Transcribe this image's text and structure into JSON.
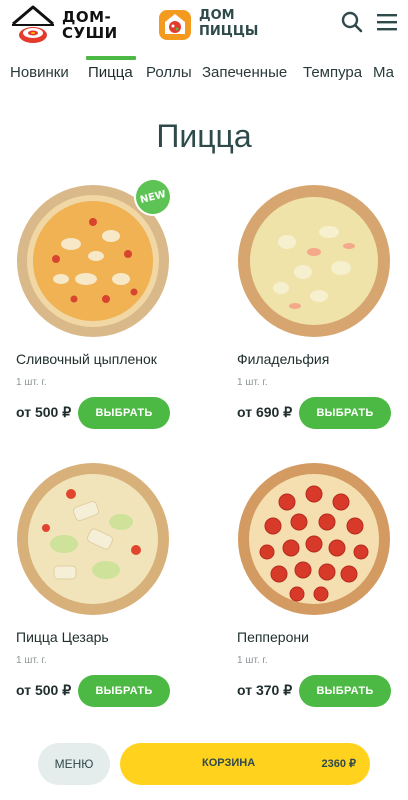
{
  "header": {
    "sushi_logo_line1": "ДОМ-",
    "sushi_logo_line2": "СУШИ",
    "pizza_logo_line1": "ДОМ",
    "pizza_logo_line2": "ПИЦЦЫ",
    "search_icon": "search-icon",
    "menu_icon": "hamburger-menu-icon"
  },
  "tabs": [
    {
      "label": "Новинки",
      "active": false
    },
    {
      "label": "Пицца",
      "active": true
    },
    {
      "label": "Роллы",
      "active": false
    },
    {
      "label": "Запеченные",
      "active": false
    },
    {
      "label": "Темпура",
      "active": false
    },
    {
      "label": "Ма",
      "active": false
    }
  ],
  "page_title": "Пицца",
  "products": [
    {
      "name": "Сливочный цыпленок",
      "unit": "1 шт. г.",
      "price": "от 500 ₽",
      "button": "ВЫБРАТЬ",
      "badge": "NEW",
      "style": "chicken"
    },
    {
      "name": "Филадельфия",
      "unit": "1 шт. г.",
      "price": "от 690 ₽",
      "button": "ВЫБРАТЬ",
      "badge": "",
      "style": "philadelphia"
    },
    {
      "name": "Пицца Цезарь",
      "unit": "1 шт. г.",
      "price": "от 500 ₽",
      "button": "ВЫБРАТЬ",
      "badge": "",
      "style": "caesar"
    },
    {
      "name": "Пепперони",
      "unit": "1 шт. г.",
      "price": "от 370 ₽",
      "button": "ВЫБРАТЬ",
      "badge": "",
      "style": "pepperoni"
    }
  ],
  "bottom_bar": {
    "menu_label": "МЕНЮ",
    "cart_label": "КОРЗИНА",
    "cart_total": "2360 ₽"
  },
  "colors": {
    "accent_green": "#4cb944",
    "cart_yellow": "#ffd21e",
    "title_teal": "#2f4a4a"
  }
}
